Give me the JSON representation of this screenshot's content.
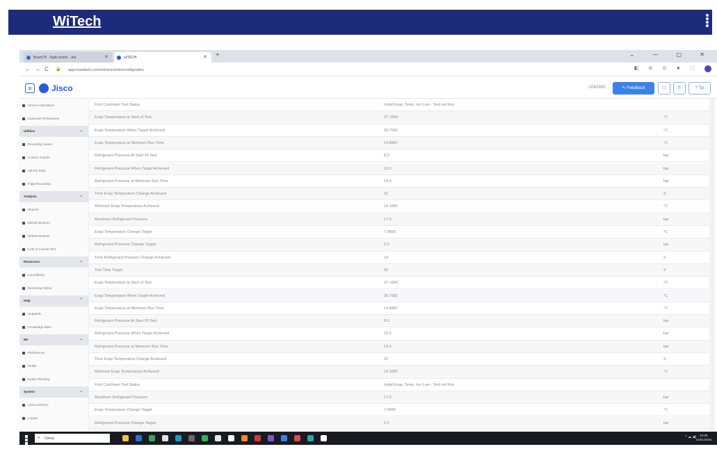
{
  "banner": {
    "title": "WiTech"
  },
  "browser": {
    "tabs": [
      {
        "label": "Board PI - Agile board - Jira",
        "fav_color": "#2a6dd8"
      },
      {
        "label": "wiTECH",
        "fav_color": "#2a5bd7"
      }
    ],
    "new_tab": "+",
    "window_controls": "⌄ — ▢ ✕",
    "url": "apps.fcawitech.com/vehicles/vehicleconfiguration",
    "extensions": "◧ ⊘ ⊙ ★ ⬚"
  },
  "app_header": {
    "logo_text": "Jisco",
    "user_id": "U04339S",
    "feedback_label": "Feedback",
    "btn1": "▢",
    "btn2": "⎘",
    "btn3": "? Tip"
  },
  "sidebar": {
    "entries": [
      {
        "kind": "item",
        "label": "Service Operations"
      },
      {
        "kind": "item",
        "label": "Customer Preferences"
      },
      {
        "kind": "section",
        "label": "Utilities",
        "chevron": "⌄"
      },
      {
        "kind": "item",
        "label": "Recording Viewer"
      },
      {
        "kind": "item",
        "label": "Custom Graphs"
      },
      {
        "kind": "item",
        "label": "Vehicle Data"
      },
      {
        "kind": "item",
        "label": "Flight Recording"
      },
      {
        "kind": "section",
        "label": "Analysis",
        "chevron": "⌄"
      },
      {
        "kind": "item",
        "label": "Reports"
      },
      {
        "kind": "item",
        "label": "DBCM Monitors"
      },
      {
        "kind": "item",
        "label": "Global Monitors"
      },
      {
        "kind": "item",
        "label": "Lists of Current Test"
      },
      {
        "kind": "section",
        "label": "Resources",
        "chevron": "⌄"
      },
      {
        "kind": "item",
        "label": "Local library"
      },
      {
        "kind": "item",
        "label": "Workshop Online"
      },
      {
        "kind": "section",
        "label": "Help",
        "chevron": "⌃"
      },
      {
        "kind": "item",
        "label": "Helpdesk"
      },
      {
        "kind": "item",
        "label": "Knowledge Base"
      },
      {
        "kind": "section",
        "label": "Me",
        "chevron": "⌄"
      },
      {
        "kind": "item",
        "label": "Preferences"
      },
      {
        "kind": "item",
        "label": "Profile"
      },
      {
        "kind": "item",
        "label": "Dealer Ranking"
      },
      {
        "kind": "section",
        "label": "System",
        "chevron": "⌄"
      },
      {
        "kind": "item",
        "label": "About wiTECH"
      },
      {
        "kind": "item",
        "label": "Logout"
      }
    ]
  },
  "table": {
    "rows": [
      {
        "name": "First Cooldown Test Status",
        "value": "Initial Evap. Temp. too Low - Test not Run",
        "unit": ""
      },
      {
        "name": "Evap Temperature at Start of Test",
        "value": "37.1064",
        "unit": "°C"
      },
      {
        "name": "Evap Temperature When Target Achieved",
        "value": "26.7582",
        "unit": "°C"
      },
      {
        "name": "Evap Temperature at Minimum Run Time",
        "value": "14.8987",
        "unit": "°C"
      },
      {
        "name": "Refrigerant Pressure At Start Of Test",
        "value": "8.0",
        "unit": "bar"
      },
      {
        "name": "Refrigerant Pressure When Target Achieved",
        "value": "10.0",
        "unit": "bar"
      },
      {
        "name": "Refrigerant Pressure at Minimum Run Time",
        "value": "14.5",
        "unit": "bar"
      },
      {
        "name": "Time Evap Temperature Change Achieved",
        "value": "22",
        "unit": "S"
      },
      {
        "name": "Minimum Evap Temperature Achieved",
        "value": "14.1082",
        "unit": "°C"
      },
      {
        "name": "Maximum Refrigerant Pressure",
        "value": "17.0",
        "unit": "bar"
      },
      {
        "name": "Evap Temperature Change Target",
        "value": "7.0890",
        "unit": "°C"
      },
      {
        "name": "Refrigerant Pressure Change Target",
        "value": "2.0",
        "unit": "bar"
      },
      {
        "name": "Time Refrigerant Pressure Change Achieved",
        "value": "14",
        "unit": "S"
      },
      {
        "name": "Test Time Target",
        "value": "60",
        "unit": "S"
      },
      {
        "name": "Evap Temperature at Start of Test",
        "value": "37.1064",
        "unit": "°C"
      },
      {
        "name": "Evap Temperature When Target Achieved",
        "value": "26.7582",
        "unit": "°C"
      },
      {
        "name": "Evap Temperature at Minimum Run Time",
        "value": "14.8987",
        "unit": "°C"
      },
      {
        "name": "Refrigerant Pressure At Start Of Test",
        "value": "8.0",
        "unit": "bar"
      },
      {
        "name": "Refrigerant Pressure When Target Achieved",
        "value": "10.0",
        "unit": "bar"
      },
      {
        "name": "Refrigerant Pressure at Minimum Run Time",
        "value": "14.5",
        "unit": "bar"
      },
      {
        "name": "Time Evap Temperature Change Achieved",
        "value": "22",
        "unit": "S"
      },
      {
        "name": "Minimum Evap Temperature Achieved",
        "value": "14.1082",
        "unit": "°C"
      },
      {
        "name": "First Cooldown Test Status",
        "value": "Initial Evap. Temp. too Low - Test not Run",
        "unit": ""
      },
      {
        "name": "Maximum Refrigerant Pressure",
        "value": "17.0",
        "unit": "bar"
      },
      {
        "name": "Evap Temperature Change Target",
        "value": "7.0890",
        "unit": "°C"
      },
      {
        "name": "Refrigerant Pressure Change Target",
        "value": "2.0",
        "unit": "bar"
      }
    ]
  },
  "taskbar": {
    "search_placeholder": "Cerca",
    "apps": [
      {
        "name": "file-explorer",
        "color": "#f2c14e"
      },
      {
        "name": "app-blue",
        "color": "#2f6fd6"
      },
      {
        "name": "app-green",
        "color": "#3aa35a"
      },
      {
        "name": "chrome",
        "color": "#e0e0e0"
      },
      {
        "name": "app-teal",
        "color": "#1d9bc9"
      },
      {
        "name": "app-dark",
        "color": "#6a6a6a"
      },
      {
        "name": "app-green2",
        "color": "#2fb35f"
      },
      {
        "name": "app-white",
        "color": "#e8e8e8"
      },
      {
        "name": "app-white2",
        "color": "#ffffff"
      },
      {
        "name": "app-orange",
        "color": "#f08a24"
      },
      {
        "name": "app-red",
        "color": "#d03c3c"
      },
      {
        "name": "app-purple",
        "color": "#7a5ac8"
      },
      {
        "name": "app-blue2",
        "color": "#3b82e6"
      },
      {
        "name": "app-red2",
        "color": "#e04848"
      },
      {
        "name": "app-teal2",
        "color": "#2aa7a7"
      },
      {
        "name": "app-white3",
        "color": "#ffffff"
      }
    ],
    "tray": "^ ☁ ◀)",
    "time": "10:08",
    "date": "21/01/2025"
  }
}
